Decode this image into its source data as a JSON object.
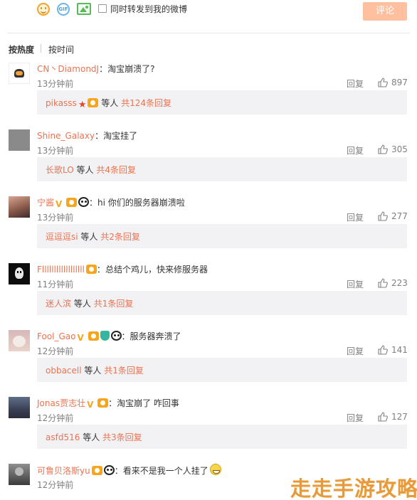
{
  "composer": {
    "repost_label": "同时转发到我的微博",
    "submit_label": "评论",
    "icons": [
      "smile-icon",
      "gif-icon",
      "image-icon"
    ],
    "gif_text": "GIF"
  },
  "sort_tabs": {
    "hot_label": "按热度",
    "time_label": "按时间"
  },
  "labels": {
    "reply": "回复",
    "colon": "："
  },
  "colors": {
    "username": "#eb7350",
    "submit_button": "#ffc09f",
    "sub_reply_bg": "#f2f2f5"
  },
  "comments": [
    {
      "user": "CN丶DiamondJ",
      "text": "淘宝崩溃了?",
      "time": "13分钟前",
      "likes": "897",
      "sub_user": "pikasss",
      "sub_suffix": "等人",
      "sub_count": "共124条回复"
    },
    {
      "user": "Shine_Galaxy",
      "text": "淘宝挂了",
      "time": "13分钟前",
      "likes": "305",
      "sub_user": "长歌LO",
      "sub_suffix": "等人",
      "sub_count": "共4条回复"
    },
    {
      "user": "宁酱",
      "text": "hi 你们的服务器崩溃啦",
      "time": "13分钟前",
      "likes": "277",
      "sub_user": "逗逗逗si",
      "sub_suffix": "等人",
      "sub_count": "共2条回复"
    },
    {
      "user": "Fllllllllllllllllll",
      "text": "总结个鸡儿，快来修服务器",
      "time": "11分钟前",
      "likes": "223",
      "sub_user": "迷人滨",
      "sub_suffix": "等人",
      "sub_count": "共1条回复"
    },
    {
      "user": "Fool_Gao",
      "text": "服务器奔溃了",
      "time": "12分钟前",
      "likes": "141",
      "sub_user": "obbacell",
      "sub_suffix": "等人",
      "sub_count": "共1条回复"
    },
    {
      "user": "Jonas贾志壮",
      "text": "淘宝崩了 咋回事",
      "time": "12分钟前",
      "likes": "127",
      "sub_user": "asfd516",
      "sub_suffix": "等人",
      "sub_count": "共3条回复"
    },
    {
      "user": "可鲁贝洛斯yu",
      "text": "看来不是我一个人挂了",
      "time": "12分钟前"
    }
  ],
  "watermark": "走走手游攻略"
}
